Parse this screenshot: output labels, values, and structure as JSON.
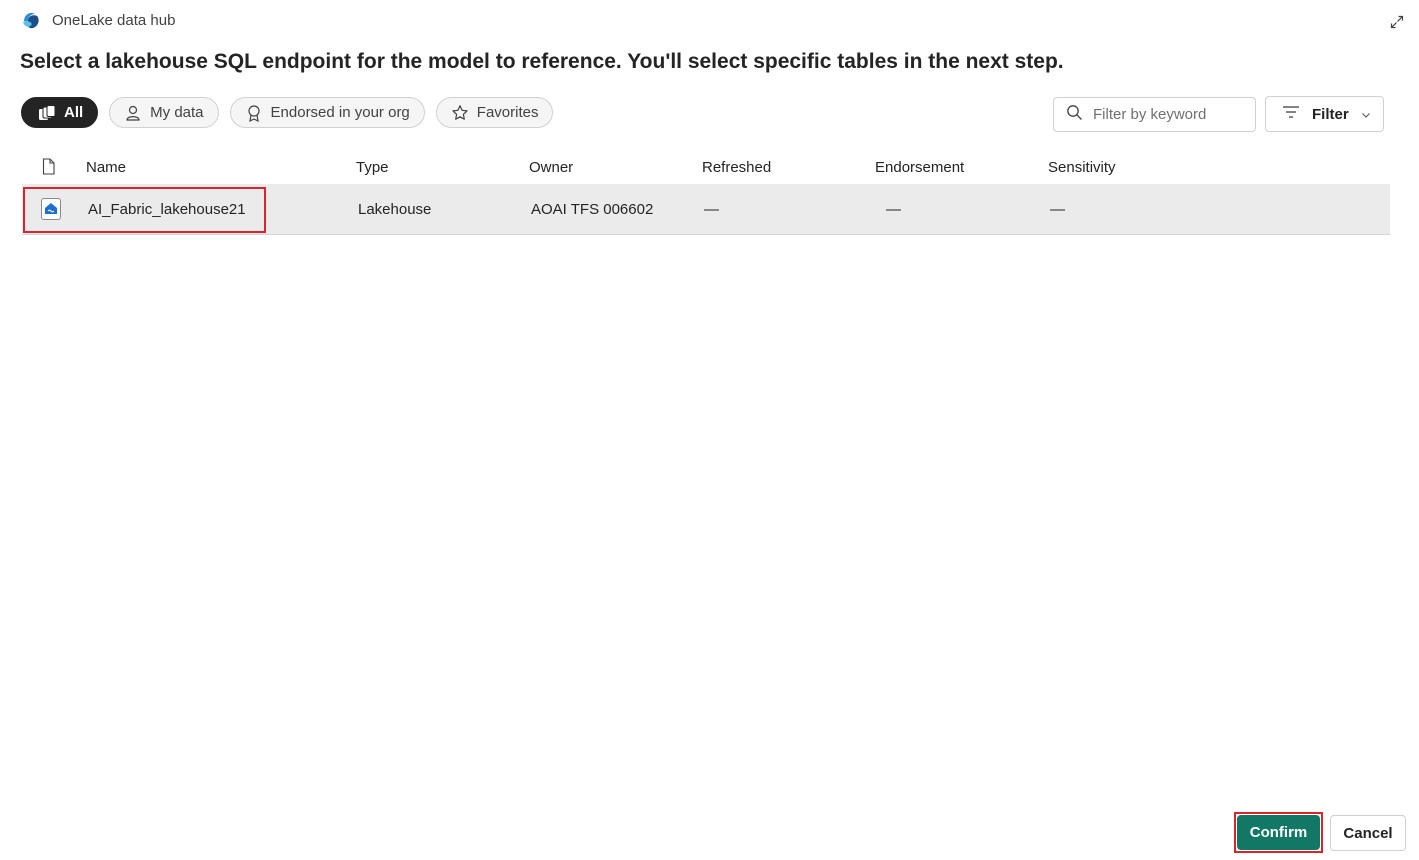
{
  "dialog": {
    "app_title": "OneLake data hub",
    "logo_icon": "onelake-logo-icon",
    "expand_icon": "expand-icon",
    "page_title": "Select a lakehouse SQL endpoint for the model to reference. You'll select specific tables in the next step."
  },
  "filters": {
    "pills": [
      {
        "label": "All",
        "icon": "all-items-icon",
        "active": true
      },
      {
        "label": "My data",
        "icon": "person-icon",
        "active": false
      },
      {
        "label": "Endorsed in your org",
        "icon": "ribbon-icon",
        "active": false
      },
      {
        "label": "Favorites",
        "icon": "star-icon",
        "active": false
      }
    ],
    "search_placeholder": "Filter by keyword",
    "filter_label": "Filter"
  },
  "table": {
    "columns": [
      "Name",
      "Type",
      "Owner",
      "Refreshed",
      "Endorsement",
      "Sensitivity"
    ],
    "rows": [
      {
        "name": "AI_Fabric_lakehouse21",
        "type": "Lakehouse",
        "owner": "AOAI TFS 006602",
        "refreshed": "—",
        "endorsement": "—",
        "sensitivity": "—",
        "selected": true
      }
    ]
  },
  "footer": {
    "confirm_label": "Confirm",
    "cancel_label": "Cancel"
  },
  "colors": {
    "primary_button": "#117865",
    "highlight_box": "#d92530",
    "active_pill": "#242424",
    "selected_row": "#ebebeb"
  }
}
